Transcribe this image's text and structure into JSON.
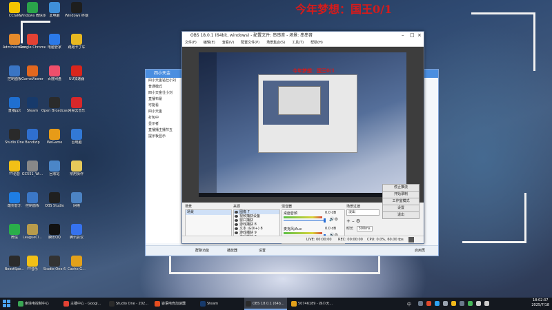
{
  "wallpaper_text": "今年梦想：国王0/1",
  "desktop_icons": [
    {
      "label": "CCtalk",
      "color": "#f5c400"
    },
    {
      "label": "Windows 微信多开",
      "color": "#2aa34a"
    },
    {
      "label": "此电脑",
      "color": "#3f8fd8"
    },
    {
      "label": "Windows 终端",
      "color": "#1e1e1e"
    },
    {
      "label": "Administrator",
      "color": "#e58a2b"
    },
    {
      "label": "Google Chrome",
      "color": "#e34234"
    },
    {
      "label": "电脑管家",
      "color": "#2b79e8"
    },
    {
      "label": "跑跑卡丁车",
      "color": "#e8b820"
    },
    {
      "label": "控制面板",
      "color": "#3a75c4"
    },
    {
      "label": "GameViewer",
      "color": "#e2671e"
    },
    {
      "label": "百度网盘",
      "color": "#ef4f6b"
    },
    {
      "label": "UU加速器",
      "color": "#d9251c"
    },
    {
      "label": "直播ppt",
      "color": "#1f6fd0"
    },
    {
      "label": "Steam",
      "color": "#173a6b"
    },
    {
      "label": "Open Broadcast",
      "color": "#2b2b2b"
    },
    {
      "label": "网易云音乐",
      "color": "#d7272a"
    },
    {
      "label": "Studio One",
      "color": "#2a2a2a"
    },
    {
      "label": "Bandizip",
      "color": "#2f6fcf"
    },
    {
      "label": "WeGame",
      "color": "#e79b18"
    },
    {
      "label": "台电脑",
      "color": "#3279d6"
    },
    {
      "label": "YY语音",
      "color": "#f2c016"
    },
    {
      "label": "GC551_Wi...",
      "color": "#888888"
    },
    {
      "label": "回收站",
      "color": "#4b86c8"
    },
    {
      "label": "常用操作",
      "color": "#e6c95a"
    },
    {
      "label": "酷狗音乐",
      "color": "#1e7de3"
    },
    {
      "label": "控制面板",
      "color": "#3b77c6"
    },
    {
      "label": "OBS Studio",
      "color": "#202020"
    },
    {
      "label": "网络",
      "color": "#4c83c3"
    },
    {
      "label": "微信",
      "color": "#2aae4a"
    },
    {
      "label": "LeagueCl...",
      "color": "#b89b4b"
    },
    {
      "label": "腾讯QQ",
      "color": "#111111"
    },
    {
      "label": "腾讯会议",
      "color": "#3672ee"
    },
    {
      "label": "BoostSpe...",
      "color": "#2b2b2b"
    },
    {
      "label": "YY音乐",
      "color": "#f2c016"
    },
    {
      "label": "Studio One 6",
      "color": "#333333"
    },
    {
      "label": "Cache G...",
      "color": "#e3a11a"
    }
  ],
  "qq_window": {
    "title": "四小天金",
    "list": [
      "四小天金钻仕小刘",
      "普通模式",
      "四小天金仕小刘",
      "直播布景",
      "可能看",
      "四小天金",
      "打包中",
      "显示者",
      "直播播主播节五",
      "提示板显示"
    ],
    "bottom_buttons": [
      "群聊功能",
      "播放器",
      "设置",
      "启用再",
      "应用"
    ]
  },
  "obs": {
    "title": "OBS 18.0.1 (64bit, windows) - 配置文件: 串串音 - 场景: 串串音",
    "menu": [
      "文件(F)",
      "编辑(E)",
      "查看(V)",
      "配置文件(P)",
      "场景集合(S)",
      "工具(T)",
      "帮助(H)"
    ],
    "preview_text": "今年梦想：国王0/1",
    "panels": {
      "scenes": "场景",
      "sources": "来源",
      "mixer": "混音器",
      "transitions": "场景过渡"
    },
    "scene_item": "场景",
    "sources": [
      "图像 7",
      "视频捕获设备",
      "窗口捕获",
      "游戏捕获 8",
      "文本 (GDI+) 8",
      "游戏捕获 9",
      "游戏捕获 7"
    ],
    "mixer": [
      {
        "name": "桌面音频",
        "value": "0.0 dB"
      },
      {
        "name": "麦克风/Aux",
        "value": "0.0 dB"
      }
    ],
    "transition": {
      "type": "淡出",
      "duration_label": "时长",
      "duration": "300ms"
    },
    "controls": [
      "停止推流",
      "开始录制",
      "工作室模式",
      "设置",
      "退出"
    ],
    "status": {
      "live": "LIVE: 00:00:00",
      "rec": "REC: 00:00:00",
      "cpu": "CPU: 0.0%, 60.00 fps"
    }
  },
  "taskbar": {
    "apps": [
      {
        "label": "索境电控制中心",
        "color": "#3aa654",
        "active": false
      },
      {
        "label": "主播中心 - Googl...",
        "color": "#e34234",
        "active": false
      },
      {
        "label": "Studio One - 202...",
        "color": "#2a2a2a",
        "active": false
      },
      {
        "label": "姿语电竞加速器",
        "color": "#e64d1f",
        "active": false
      },
      {
        "label": "Steam",
        "color": "#173a6b",
        "active": false
      },
      {
        "label": "OBS 18.0.1 (64b...",
        "color": "#2b2b2b",
        "active": true
      },
      {
        "label": "50746189 - 四小天...",
        "color": "#e3a11a",
        "active": false
      }
    ],
    "tray_lang": "中",
    "time": "18:02:37",
    "date": "2025/7/18"
  }
}
